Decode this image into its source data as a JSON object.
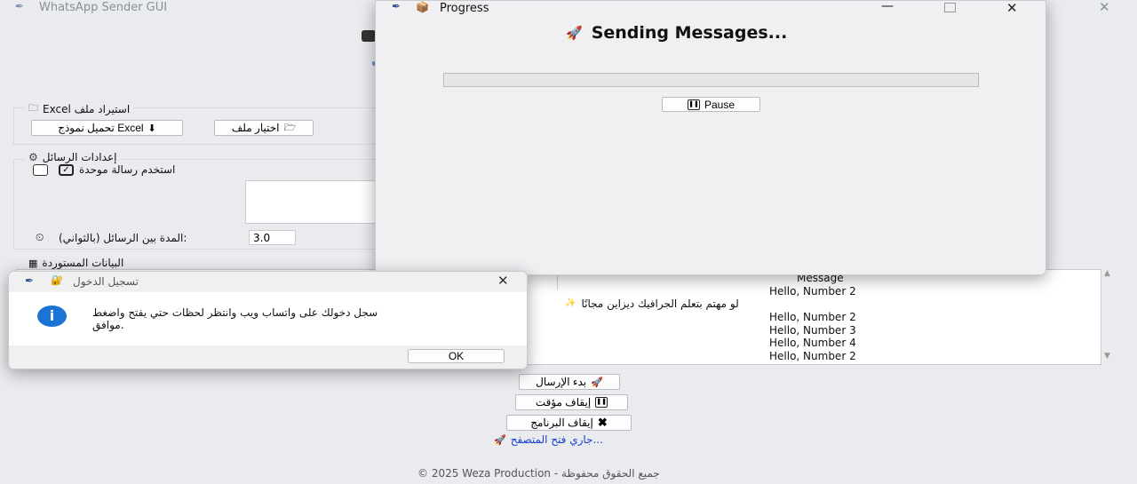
{
  "main_window": {
    "title": "WhatsApp Sender GUI",
    "excel_frame": {
      "title": "استيراد ملف Excel",
      "download_template_button": "تحميل نموذج Excel",
      "choose_file_button": "اختيار ملف"
    },
    "message_frame": {
      "title": "إعدادات الرسائل",
      "use_unified_label": "استخدم رسالة موحدة",
      "interval_label": "المدة بين الرسائل (بالثواني):",
      "interval_value": "3.0"
    },
    "data_frame": {
      "title": "البيانات المستوردة",
      "column_header": "Message",
      "rows": [
        "Hello, Number 2",
        "لو مهتم بتعلم الجرافيك ديزاين مجانًا",
        "Hello, Number 2",
        "Hello, Number 3",
        "Hello, Number 4",
        "Hello, Number 2"
      ]
    },
    "start_button": "بدء الإرسال",
    "pause_button": "إيقاف مؤقت",
    "stop_button": "إيقاف البرنامج",
    "status_text": "جاري فتح المتصفح...",
    "footer": "© 2025 Weza Production - جميع الحقوق محفوظة"
  },
  "progress_window": {
    "title": "Progress",
    "heading": "Sending Messages...",
    "progress": 0,
    "pause_button": "Pause"
  },
  "login_dialog": {
    "title": "تسجيل الدخول",
    "message_line1": "سجل دخولك على واتساب ويب وانتظر لحظات حتي يفتح واضغط",
    "message_line2": "موافق.",
    "ok_button": "OK"
  },
  "colors": {
    "accent_blue": "#1f6fd6",
    "status_blue": "#1a3fd0",
    "info_icon": "#1b74d3"
  }
}
